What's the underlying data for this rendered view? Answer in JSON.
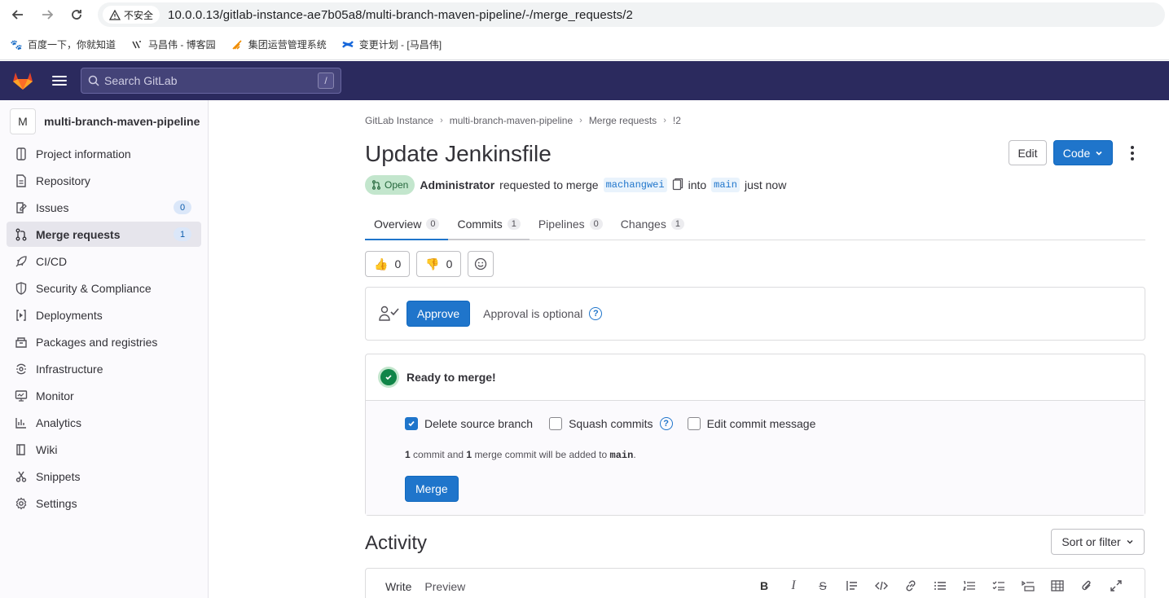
{
  "browser": {
    "security_label": "不安全",
    "url": "10.0.0.13/gitlab-instance-ae7b05a8/multi-branch-maven-pipeline/-/merge_requests/2",
    "bookmarks": [
      "百度一下，你就知道",
      "马昌伟 - 博客园",
      "集团运营管理系统",
      "变更计划 - [马昌伟]"
    ]
  },
  "topbar": {
    "search_placeholder": "Search GitLab",
    "search_shortcut": "/"
  },
  "sidebar": {
    "project_initial": "M",
    "project_name": "multi-branch-maven-pipeline",
    "items": [
      {
        "label": "Project information",
        "icon": "info-icon"
      },
      {
        "label": "Repository",
        "icon": "document-icon"
      },
      {
        "label": "Issues",
        "icon": "issues-icon",
        "count": "0"
      },
      {
        "label": "Merge requests",
        "icon": "merge-request-icon",
        "count": "1",
        "active": true
      },
      {
        "label": "CI/CD",
        "icon": "rocket-icon"
      },
      {
        "label": "Security & Compliance",
        "icon": "shield-icon"
      },
      {
        "label": "Deployments",
        "icon": "deployments-icon"
      },
      {
        "label": "Packages and registries",
        "icon": "package-icon"
      },
      {
        "label": "Infrastructure",
        "icon": "cloud-icon"
      },
      {
        "label": "Monitor",
        "icon": "monitor-icon"
      },
      {
        "label": "Analytics",
        "icon": "chart-icon"
      },
      {
        "label": "Wiki",
        "icon": "book-icon"
      },
      {
        "label": "Snippets",
        "icon": "scissors-icon"
      },
      {
        "label": "Settings",
        "icon": "gear-icon"
      }
    ]
  },
  "breadcrumb": [
    "GitLab Instance",
    "multi-branch-maven-pipeline",
    "Merge requests",
    "!2"
  ],
  "mr": {
    "title": "Update Jenkinsfile",
    "edit_label": "Edit",
    "code_label": "Code",
    "status": "Open",
    "author": "Administrator",
    "requested_text": "requested to merge",
    "source_branch": "machangwei",
    "into_text": "into",
    "target_branch": "main",
    "time": "just now"
  },
  "tabs": [
    {
      "label": "Overview",
      "count": "0"
    },
    {
      "label": "Commits",
      "count": "1"
    },
    {
      "label": "Pipelines",
      "count": "0"
    },
    {
      "label": "Changes",
      "count": "1"
    }
  ],
  "reactions": {
    "thumbs_up": "0",
    "thumbs_down": "0"
  },
  "approval": {
    "button": "Approve",
    "text": "Approval is optional"
  },
  "merge": {
    "status": "Ready to merge!",
    "delete_source": "Delete source branch",
    "squash": "Squash commits",
    "edit_message": "Edit commit message",
    "note_count1": "1",
    "note_text1": "commit and",
    "note_count2": "1",
    "note_text2": "merge commit will be added to",
    "note_branch": "main",
    "button": "Merge"
  },
  "activity": {
    "title": "Activity",
    "sort_label": "Sort or filter",
    "write_tab": "Write",
    "preview_tab": "Preview"
  },
  "colors": {
    "topbar": "#2b2a5e",
    "primary": "#1f75cb",
    "success": "#108548"
  }
}
